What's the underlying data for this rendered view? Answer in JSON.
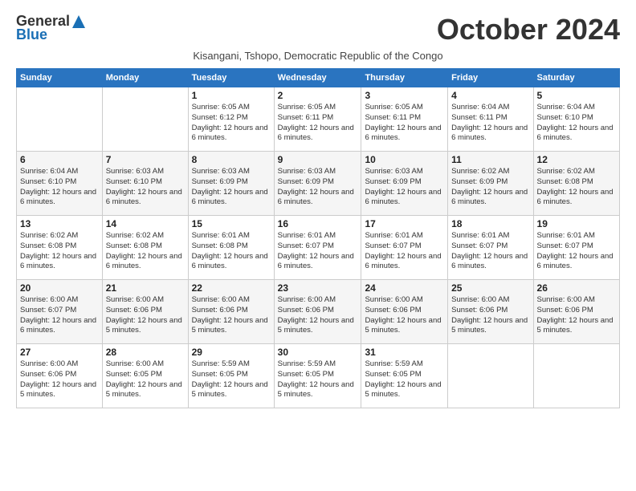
{
  "logo": {
    "general": "General",
    "blue": "Blue"
  },
  "title": "October 2024",
  "subtitle": "Kisangani, Tshopo, Democratic Republic of the Congo",
  "days_of_week": [
    "Sunday",
    "Monday",
    "Tuesday",
    "Wednesday",
    "Thursday",
    "Friday",
    "Saturday"
  ],
  "weeks": [
    [
      {
        "day": "",
        "info": ""
      },
      {
        "day": "",
        "info": ""
      },
      {
        "day": "1",
        "info": "Sunrise: 6:05 AM\nSunset: 6:12 PM\nDaylight: 12 hours and 6 minutes."
      },
      {
        "day": "2",
        "info": "Sunrise: 6:05 AM\nSunset: 6:11 PM\nDaylight: 12 hours and 6 minutes."
      },
      {
        "day": "3",
        "info": "Sunrise: 6:05 AM\nSunset: 6:11 PM\nDaylight: 12 hours and 6 minutes."
      },
      {
        "day": "4",
        "info": "Sunrise: 6:04 AM\nSunset: 6:11 PM\nDaylight: 12 hours and 6 minutes."
      },
      {
        "day": "5",
        "info": "Sunrise: 6:04 AM\nSunset: 6:10 PM\nDaylight: 12 hours and 6 minutes."
      }
    ],
    [
      {
        "day": "6",
        "info": "Sunrise: 6:04 AM\nSunset: 6:10 PM\nDaylight: 12 hours and 6 minutes."
      },
      {
        "day": "7",
        "info": "Sunrise: 6:03 AM\nSunset: 6:10 PM\nDaylight: 12 hours and 6 minutes."
      },
      {
        "day": "8",
        "info": "Sunrise: 6:03 AM\nSunset: 6:09 PM\nDaylight: 12 hours and 6 minutes."
      },
      {
        "day": "9",
        "info": "Sunrise: 6:03 AM\nSunset: 6:09 PM\nDaylight: 12 hours and 6 minutes."
      },
      {
        "day": "10",
        "info": "Sunrise: 6:03 AM\nSunset: 6:09 PM\nDaylight: 12 hours and 6 minutes."
      },
      {
        "day": "11",
        "info": "Sunrise: 6:02 AM\nSunset: 6:09 PM\nDaylight: 12 hours and 6 minutes."
      },
      {
        "day": "12",
        "info": "Sunrise: 6:02 AM\nSunset: 6:08 PM\nDaylight: 12 hours and 6 minutes."
      }
    ],
    [
      {
        "day": "13",
        "info": "Sunrise: 6:02 AM\nSunset: 6:08 PM\nDaylight: 12 hours and 6 minutes."
      },
      {
        "day": "14",
        "info": "Sunrise: 6:02 AM\nSunset: 6:08 PM\nDaylight: 12 hours and 6 minutes."
      },
      {
        "day": "15",
        "info": "Sunrise: 6:01 AM\nSunset: 6:08 PM\nDaylight: 12 hours and 6 minutes."
      },
      {
        "day": "16",
        "info": "Sunrise: 6:01 AM\nSunset: 6:07 PM\nDaylight: 12 hours and 6 minutes."
      },
      {
        "day": "17",
        "info": "Sunrise: 6:01 AM\nSunset: 6:07 PM\nDaylight: 12 hours and 6 minutes."
      },
      {
        "day": "18",
        "info": "Sunrise: 6:01 AM\nSunset: 6:07 PM\nDaylight: 12 hours and 6 minutes."
      },
      {
        "day": "19",
        "info": "Sunrise: 6:01 AM\nSunset: 6:07 PM\nDaylight: 12 hours and 6 minutes."
      }
    ],
    [
      {
        "day": "20",
        "info": "Sunrise: 6:00 AM\nSunset: 6:07 PM\nDaylight: 12 hours and 6 minutes."
      },
      {
        "day": "21",
        "info": "Sunrise: 6:00 AM\nSunset: 6:06 PM\nDaylight: 12 hours and 5 minutes."
      },
      {
        "day": "22",
        "info": "Sunrise: 6:00 AM\nSunset: 6:06 PM\nDaylight: 12 hours and 5 minutes."
      },
      {
        "day": "23",
        "info": "Sunrise: 6:00 AM\nSunset: 6:06 PM\nDaylight: 12 hours and 5 minutes."
      },
      {
        "day": "24",
        "info": "Sunrise: 6:00 AM\nSunset: 6:06 PM\nDaylight: 12 hours and 5 minutes."
      },
      {
        "day": "25",
        "info": "Sunrise: 6:00 AM\nSunset: 6:06 PM\nDaylight: 12 hours and 5 minutes."
      },
      {
        "day": "26",
        "info": "Sunrise: 6:00 AM\nSunset: 6:06 PM\nDaylight: 12 hours and 5 minutes."
      }
    ],
    [
      {
        "day": "27",
        "info": "Sunrise: 6:00 AM\nSunset: 6:06 PM\nDaylight: 12 hours and 5 minutes."
      },
      {
        "day": "28",
        "info": "Sunrise: 6:00 AM\nSunset: 6:05 PM\nDaylight: 12 hours and 5 minutes."
      },
      {
        "day": "29",
        "info": "Sunrise: 5:59 AM\nSunset: 6:05 PM\nDaylight: 12 hours and 5 minutes."
      },
      {
        "day": "30",
        "info": "Sunrise: 5:59 AM\nSunset: 6:05 PM\nDaylight: 12 hours and 5 minutes."
      },
      {
        "day": "31",
        "info": "Sunrise: 5:59 AM\nSunset: 6:05 PM\nDaylight: 12 hours and 5 minutes."
      },
      {
        "day": "",
        "info": ""
      },
      {
        "day": "",
        "info": ""
      }
    ]
  ]
}
